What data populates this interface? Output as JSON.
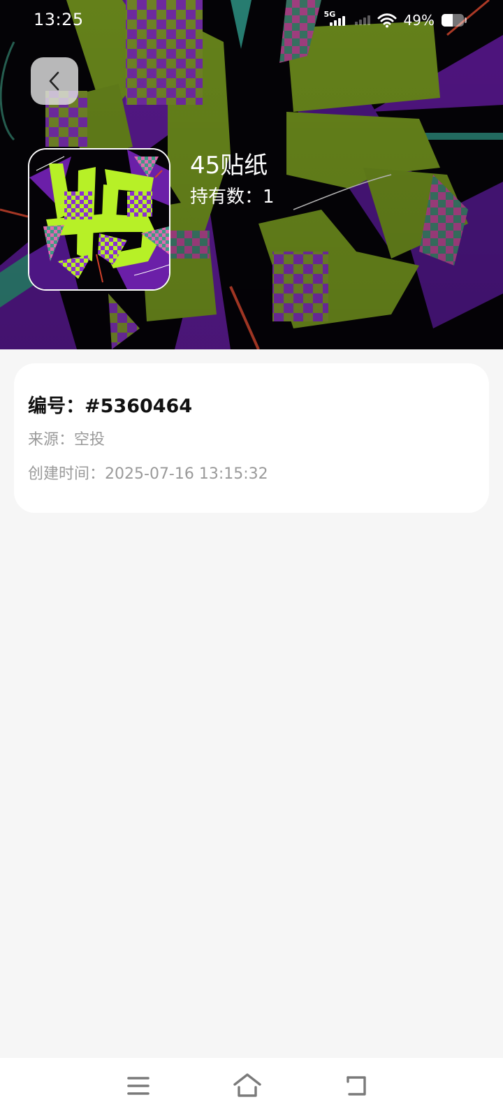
{
  "status_bar": {
    "time": "13:25",
    "network_type": "5G",
    "battery_percent": "49%",
    "battery_level": 0.49,
    "icons": [
      "signal-5g-icon",
      "signal-dim-icon",
      "wifi-icon",
      "battery-icon"
    ]
  },
  "header": {
    "back_icon": "chevron-left-icon",
    "sticker_name": "45贴纸",
    "owned_label": "持有数：",
    "owned_count": "1"
  },
  "info_card": {
    "id_label": "编号：",
    "id_value": "#5360464",
    "source_label": "来源：",
    "source_value": "空投",
    "created_label": "创建时间：",
    "created_value": "2025-07-16 13:15:32"
  },
  "nav_bar": {
    "icons": [
      "menu-icon",
      "home-icon",
      "back-icon"
    ]
  },
  "colors": {
    "page_background": "#f6f6f6",
    "card_background": "#ffffff",
    "art_green": "#6f8f1d",
    "art_lime": "#b7f027",
    "art_purple": "#6b1fa8",
    "art_teal": "#2f8a7a",
    "meta_text": "#9a9a9a"
  }
}
